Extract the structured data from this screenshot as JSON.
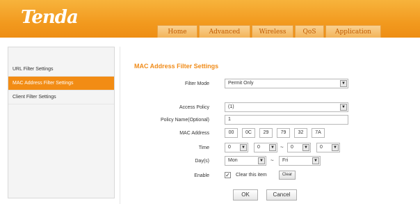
{
  "header": {
    "logo": "Tenda",
    "tabs": [
      "Home",
      "Advanced",
      "Wireless",
      "QoS",
      "Application"
    ]
  },
  "sidebar": {
    "items": [
      {
        "label": "URL Filter Settings"
      },
      {
        "label": "MAC Address Filter Settings"
      },
      {
        "label": "Client Filter Settings"
      }
    ]
  },
  "form": {
    "title": "MAC Address Filter Settings",
    "filter_mode": {
      "label": "Filter Mode",
      "value": "Permit Only"
    },
    "access_policy": {
      "label": "Access Policy",
      "value": "(1)"
    },
    "policy_name": {
      "label": "Policy Name(Optional)",
      "value": "1"
    },
    "mac_address": {
      "label": "MAC Address",
      "octets": [
        "00",
        "0C",
        "29",
        "79",
        "32",
        "7A"
      ]
    },
    "time": {
      "label": "Time",
      "start_hour": "0",
      "start_min": "0",
      "end_hour": "0",
      "end_min": "0",
      "separator": "~"
    },
    "days": {
      "label": "Day(s)",
      "from": "Mon",
      "to": "Fri",
      "separator": "~"
    },
    "enable": {
      "label": "Enable",
      "clear_text": "Clear this item",
      "clear_button": "Clear"
    },
    "ok_label": "OK",
    "cancel_label": "Cancel"
  },
  "colors": {
    "brand_orange": "#f29a1f",
    "title_orange": "#f08c1a",
    "active_item": "#f28c14"
  },
  "icons": {
    "dropdown": "chevron-down-icon",
    "checkbox": "check-icon"
  }
}
